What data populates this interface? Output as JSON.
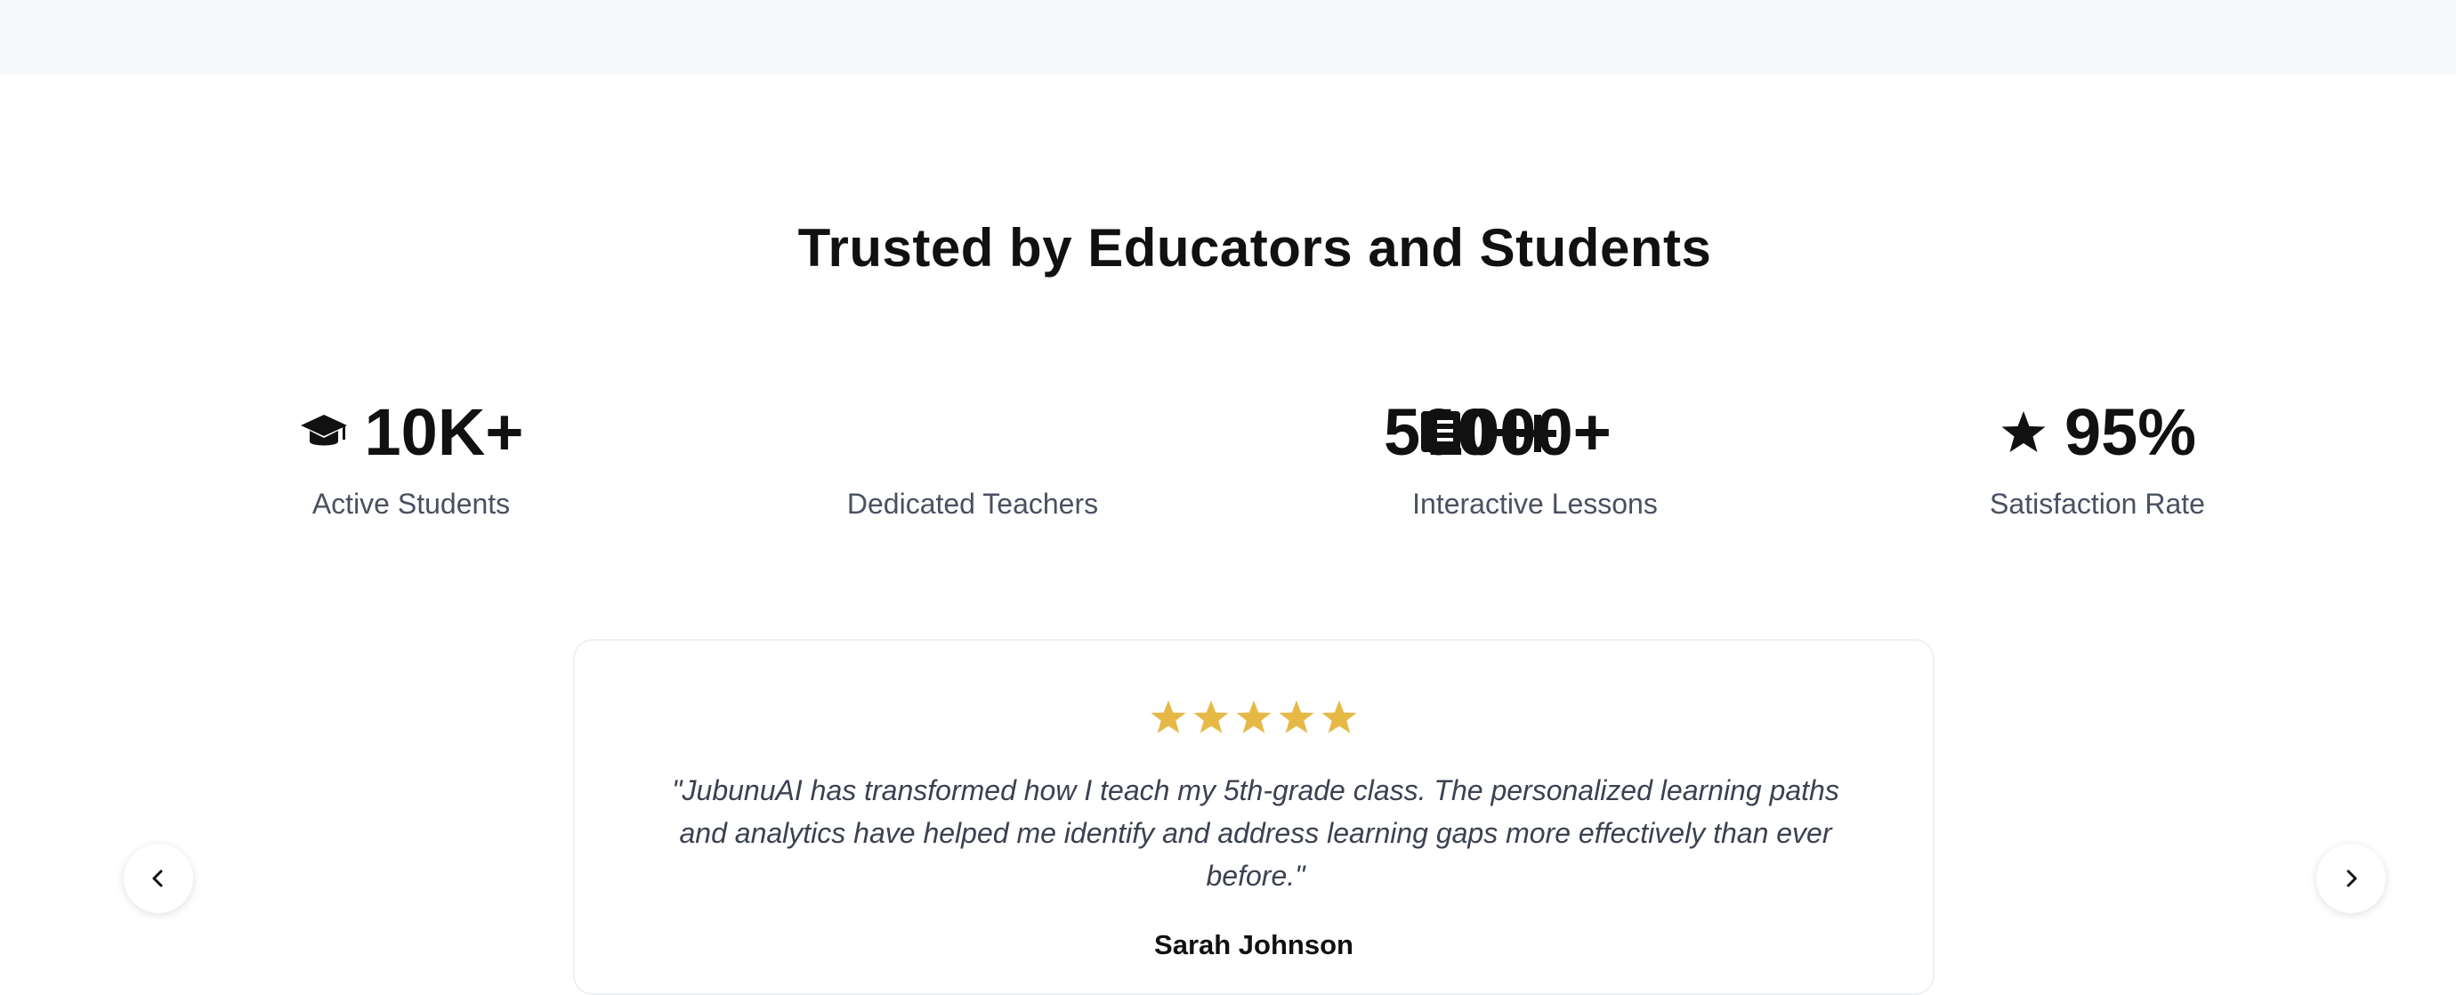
{
  "section": {
    "title": "Trusted by Educators and Students"
  },
  "stats": [
    {
      "value": "10K+",
      "label": "Active Students",
      "icon": "graduation-cap-icon"
    },
    {
      "value": "",
      "label": "Dedicated Teachers",
      "icon": ""
    },
    {
      "value": "500+",
      "value_overlap": "1000+",
      "label": "Interactive Lessons",
      "icon": "book-icon"
    },
    {
      "value": "95%",
      "label": "Satisfaction Rate",
      "icon": "star-icon"
    }
  ],
  "testimonial": {
    "rating": 5,
    "quote": "\"JubunuAI has transformed how I teach my 5th-grade class. The personalized learning paths and analytics have helped me identify and address learning gaps more effectively than ever before.\"",
    "author": "Sarah Johnson"
  },
  "carousel": {
    "prev_icon": "chevron-left-icon",
    "next_icon": "chevron-right-icon"
  },
  "colors": {
    "star": "#e6b947",
    "top_band": "#f8f9fb",
    "label_text": "#4a5060",
    "quote_text": "#3b4150"
  }
}
